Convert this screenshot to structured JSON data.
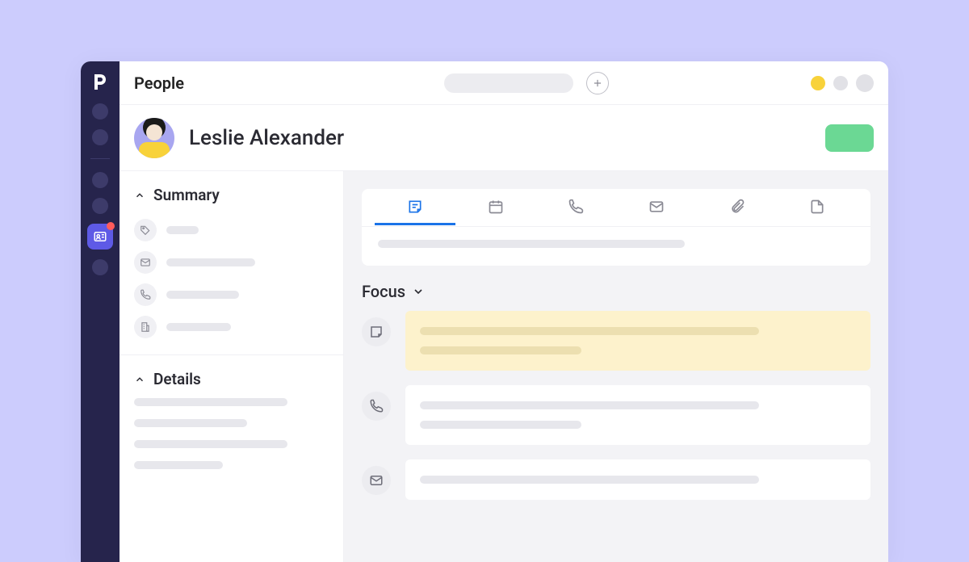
{
  "topbar": {
    "title": "People"
  },
  "person": {
    "name": "Leslie Alexander"
  },
  "sidebar_sections": {
    "summary": {
      "header": "Summary"
    },
    "details": {
      "header": "Details"
    }
  },
  "focus": {
    "header": "Focus"
  },
  "tabs": [
    {
      "id": "notes",
      "icon": "note-icon",
      "active": true
    },
    {
      "id": "activity",
      "icon": "calendar-icon",
      "active": false
    },
    {
      "id": "call",
      "icon": "phone-icon",
      "active": false
    },
    {
      "id": "email",
      "icon": "mail-icon",
      "active": false
    },
    {
      "id": "files",
      "icon": "paperclip-icon",
      "active": false
    },
    {
      "id": "docs",
      "icon": "document-icon",
      "active": false
    }
  ],
  "colors": {
    "background": "#ccccfd",
    "rail": "#26244c",
    "accent": "#5e5ae6",
    "action": "#6bd894",
    "highlight": "#fdf2cc",
    "tab_active": "#1a73e8"
  }
}
